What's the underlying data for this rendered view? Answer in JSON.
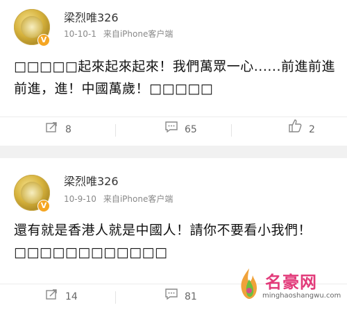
{
  "posts": [
    {
      "username": "梁烈唯326",
      "date": "10-10-1",
      "source": "来自iPhone客户端",
      "text": "□□□□□起來起來起來！我們萬眾一心......前進前進前進，進！中國萬歲！□□□□□",
      "reposts": "8",
      "comments": "65",
      "likes": "2"
    },
    {
      "username": "梁烈唯326",
      "date": "10-9-10",
      "source": "来自iPhone客户端",
      "text": "還有就是香港人就是中國人！請你不要看小我們！□□□□□□□□□□□□",
      "reposts": "14",
      "comments": "81",
      "likes": ""
    }
  ],
  "watermark": {
    "name": "名豪网",
    "url": "minghaoshangwu.com"
  }
}
